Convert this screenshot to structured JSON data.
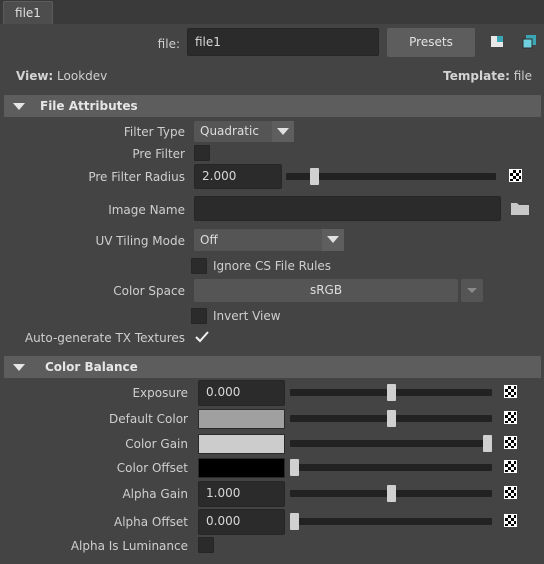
{
  "tab": {
    "label": "file1"
  },
  "file_row": {
    "label": "file:",
    "value": "file1",
    "presets_label": "Presets"
  },
  "view_line": {
    "view_label": "View:",
    "view_value": "Lookdev",
    "template_label": "Template:",
    "template_value": "file"
  },
  "file_attributes": {
    "title": "File Attributes",
    "filter_type": {
      "label": "Filter Type",
      "value": "Quadratic"
    },
    "pre_filter": {
      "label": "Pre Filter",
      "checked": false
    },
    "pre_filter_radius": {
      "label": "Pre Filter Radius",
      "value": "2.000",
      "slider_fraction": 0.12
    },
    "image_name": {
      "label": "Image Name",
      "value": ""
    },
    "uv_tiling_mode": {
      "label": "UV Tiling Mode",
      "value": "Off"
    },
    "ignore_cs_file_rules": {
      "label": "Ignore CS File Rules",
      "checked": false
    },
    "color_space": {
      "label": "Color Space",
      "value": "sRGB"
    },
    "invert_view": {
      "label": "Invert View",
      "checked": false
    },
    "auto_generate_tx": {
      "label": "Auto-generate TX Textures",
      "checked": true
    }
  },
  "color_balance": {
    "title": "Color Balance",
    "exposure": {
      "label": "Exposure",
      "value": "0.000",
      "slider_fraction": 0.5
    },
    "default_color": {
      "label": "Default Color",
      "color": "#a0a0a0",
      "slider_fraction": 0.5
    },
    "color_gain": {
      "label": "Color Gain",
      "color": "#cccccc",
      "slider_fraction": 1.0
    },
    "color_offset": {
      "label": "Color Offset",
      "color": "#000000",
      "slider_fraction": 0.0
    },
    "alpha_gain": {
      "label": "Alpha Gain",
      "value": "1.000",
      "slider_fraction": 0.5
    },
    "alpha_offset": {
      "label": "Alpha Offset",
      "value": "0.000",
      "slider_fraction": 0.0
    },
    "alpha_is_luminance": {
      "label": "Alpha Is Luminance",
      "checked": false
    }
  },
  "icons": {
    "copy_tab": "copy-tab-icon",
    "show_attr_editor": "show-attribute-editor-icon",
    "folder": "folder-icon",
    "map": "checker-map-icon"
  }
}
